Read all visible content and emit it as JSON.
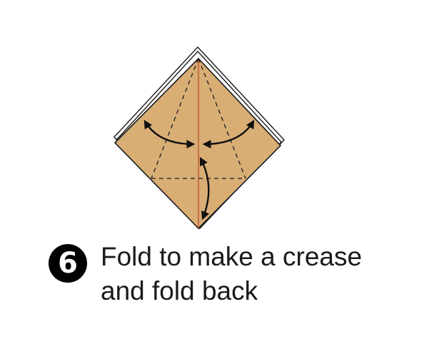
{
  "step": {
    "number": "6",
    "text_lines": [
      "Fold to make a crease",
      "and fold back"
    ]
  },
  "colors": {
    "paper": "#d8ae75",
    "outline": "#1a1a1a",
    "center_crease": "#c0502a",
    "arrows": "#111111"
  },
  "icons": {
    "step_badge": "circled-number-icon",
    "fold_arrow": "curved-fold-arrow-icon"
  }
}
